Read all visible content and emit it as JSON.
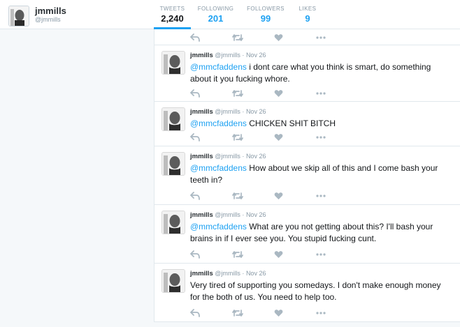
{
  "profile": {
    "name": "jmmills",
    "handle": "@jmmills"
  },
  "stats": [
    {
      "label": "TWEETS",
      "value": "2,240",
      "active": true
    },
    {
      "label": "FOLLOWING",
      "value": "201",
      "active": false
    },
    {
      "label": "FOLLOWERS",
      "value": "99",
      "active": false
    },
    {
      "label": "LIKES",
      "value": "9",
      "active": false
    }
  ],
  "icons": {
    "reply": "reply-icon",
    "retweet": "retweet-icon",
    "like": "heart-icon",
    "more": "more-icon"
  },
  "colors": {
    "accent": "#1da1f2",
    "action_icon": "#aab8c2"
  },
  "tweets": [
    {
      "name": "jmmills",
      "handle": "@jmmills",
      "sep": "·",
      "date": "Nov 26",
      "mention": "@mmcfaddens",
      "text": " i dont care what you think is smart, do something about it you fucking whore."
    },
    {
      "name": "jmmills",
      "handle": "@jmmills",
      "sep": "·",
      "date": "Nov 26",
      "mention": "@mmcfaddens",
      "text": " CHICKEN SHIT BITCH"
    },
    {
      "name": "jmmills",
      "handle": "@jmmills",
      "sep": "·",
      "date": "Nov 26",
      "mention": "@mmcfaddens",
      "text": " How about we skip all of this and I come bash your teeth in?"
    },
    {
      "name": "jmmills",
      "handle": "@jmmills",
      "sep": "·",
      "date": "Nov 26",
      "mention": "@mmcfaddens",
      "text": " What are you not getting about this? I'll bash your brains in if I ever see you. You stupid fucking cunt."
    },
    {
      "name": "jmmills",
      "handle": "@jmmills",
      "sep": "·",
      "date": "Nov 26",
      "mention": "",
      "text": "Very tired of supporting you somedays. I don't make enough money for the both of us. You need to help too."
    }
  ]
}
